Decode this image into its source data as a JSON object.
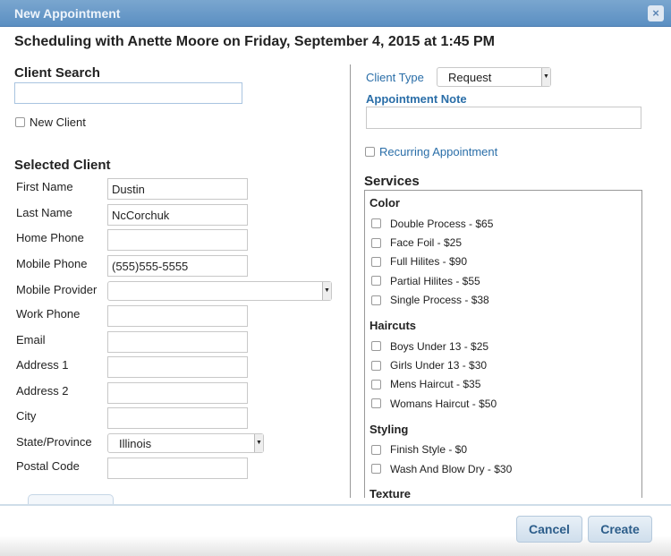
{
  "dialog": {
    "title": "New Appointment",
    "close": "×",
    "heading": "Scheduling with Anette Moore on Friday, September 4, 2015 at 1:45 PM"
  },
  "client_search": {
    "label": "Client Search",
    "value": "",
    "new_client": "New Client"
  },
  "selected_client": {
    "label": "Selected Client",
    "fields": [
      {
        "label": "First Name",
        "value": "Dustin"
      },
      {
        "label": "Last Name",
        "value": "NcCorchuk"
      },
      {
        "label": "Home Phone",
        "value": ""
      },
      {
        "label": "Mobile Phone",
        "value": "(555)555-5555"
      },
      {
        "label": "Mobile Provider",
        "value": ""
      },
      {
        "label": "Work Phone",
        "value": ""
      },
      {
        "label": "Email",
        "value": ""
      },
      {
        "label": "Address 1",
        "value": ""
      },
      {
        "label": "Address 2",
        "value": ""
      },
      {
        "label": "City",
        "value": ""
      },
      {
        "label": "State/Province",
        "value": "Illinois"
      },
      {
        "label": "Postal Code",
        "value": ""
      }
    ]
  },
  "right": {
    "client_type_label": "Client Type",
    "client_type": "Request",
    "note_label": "Appointment Note",
    "note": "",
    "recurring": "Recurring Appointment",
    "services_label": "Services"
  },
  "services": [
    {
      "category": "Color",
      "items": [
        "Double Process - $65",
        "Face Foil - $25",
        "Full Hilites - $90",
        "Partial Hilites - $55",
        "Single Process - $38"
      ]
    },
    {
      "category": "Haircuts",
      "items": [
        "Boys Under 13 - $25",
        "Girls Under 13 - $30",
        "Mens Haircut - $35",
        "Womans Haircut - $50"
      ]
    },
    {
      "category": "Styling",
      "items": [
        "Finish Style - $0",
        "Wash And Blow Dry - $30"
      ]
    },
    {
      "category": "Texture",
      "items": []
    }
  ],
  "footer": {
    "cancel": "Cancel",
    "create": "Create"
  }
}
